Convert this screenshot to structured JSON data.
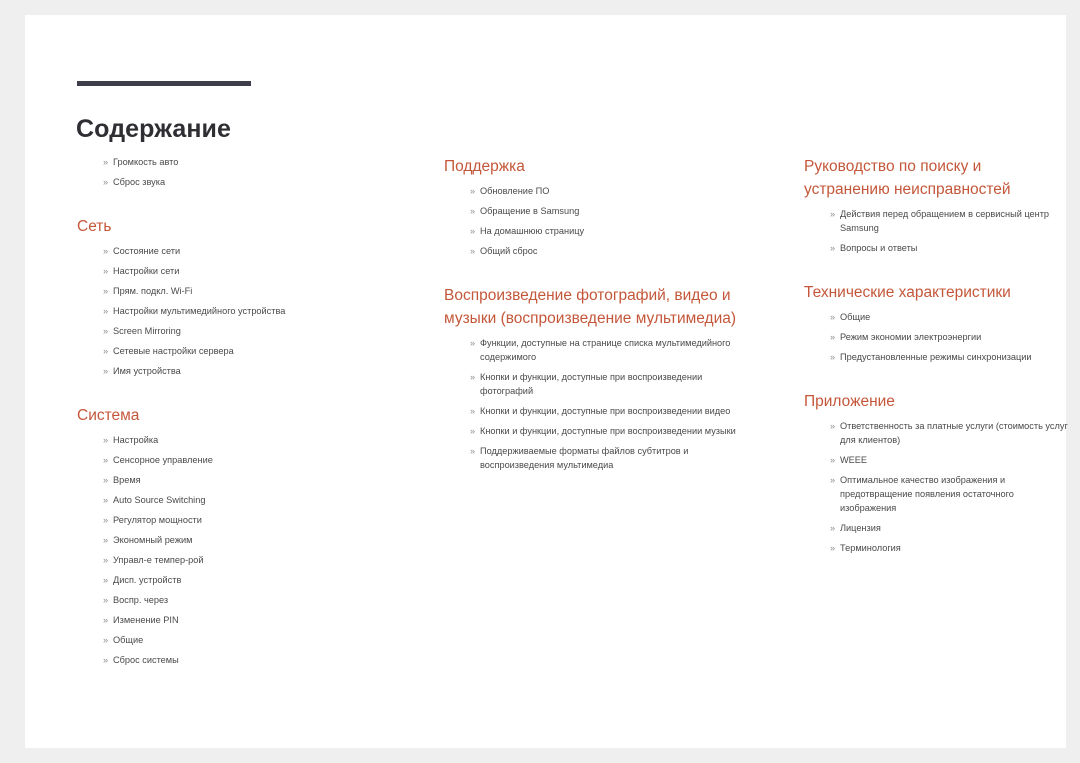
{
  "document": {
    "title": "Содержание",
    "bullet_glyph": "»",
    "accent_color": "#c4573a",
    "rule_color": "#3e3d4a",
    "body_color": "#4a4a4a",
    "page_background": "#ffffff",
    "canvas_background": "#efefef"
  },
  "columns": [
    {
      "name": "column-left",
      "lead_items": [
        "Громкость авто",
        "Сброс звука"
      ],
      "sections": [
        {
          "heading": "Сеть",
          "items": [
            "Состояние сети",
            "Настройки сети",
            "Прям. подкл. Wi-Fi",
            "Настройки мультимедийного устройства",
            "Screen Mirroring",
            "Сетевые настройки сервера",
            "Имя устройства"
          ]
        },
        {
          "heading": "Система",
          "items": [
            "Настройка",
            "Сенсорное управление",
            "Время",
            "Auto Source Switching",
            "Регулятор мощности",
            "Экономный режим",
            "Управл-е темпер-рой",
            "Дисп. устройств",
            "Воспр. через",
            "Изменение PIN",
            "Общие",
            "Сброс системы"
          ]
        }
      ]
    },
    {
      "name": "column-middle",
      "lead_items": [],
      "sections": [
        {
          "heading": "Поддержка",
          "items": [
            "Обновление ПО",
            "Обращение в Samsung",
            "На домашнюю страницу",
            "Общий сброс"
          ]
        },
        {
          "heading": "Воспроизведение фотографий, видео и музыки (воспроизведение мультимедиа)",
          "items": [
            "Функции, доступные на странице списка мультимедийного содержимого",
            "Кнопки и функции, доступные при воспроизведении фотографий",
            "Кнопки и функции, доступные при воспроизведении видео",
            "Кнопки и функции, доступные при воспроизведении музыки",
            "Поддерживаемые форматы файлов субтитров и воспроизведения мультимедиа"
          ]
        }
      ]
    },
    {
      "name": "column-right",
      "lead_items": [],
      "sections": [
        {
          "heading": "Руководство по поиску и устранению неисправностей",
          "items": [
            "Действия перед обращением в сервисный центр Samsung",
            "Вопросы и ответы"
          ]
        },
        {
          "heading": "Технические характеристики",
          "items": [
            "Общие",
            "Режим экономии электроэнергии",
            "Предустановленные режимы синхронизации"
          ]
        },
        {
          "heading": "Приложение",
          "items": [
            "Ответственность за платные услуги (стоимость услуг для клиентов)",
            "WEEE",
            "Оптимальное качество изображения и предотвращение появления остаточного изображения",
            "Лицензия",
            "Терминология"
          ]
        }
      ]
    }
  ]
}
